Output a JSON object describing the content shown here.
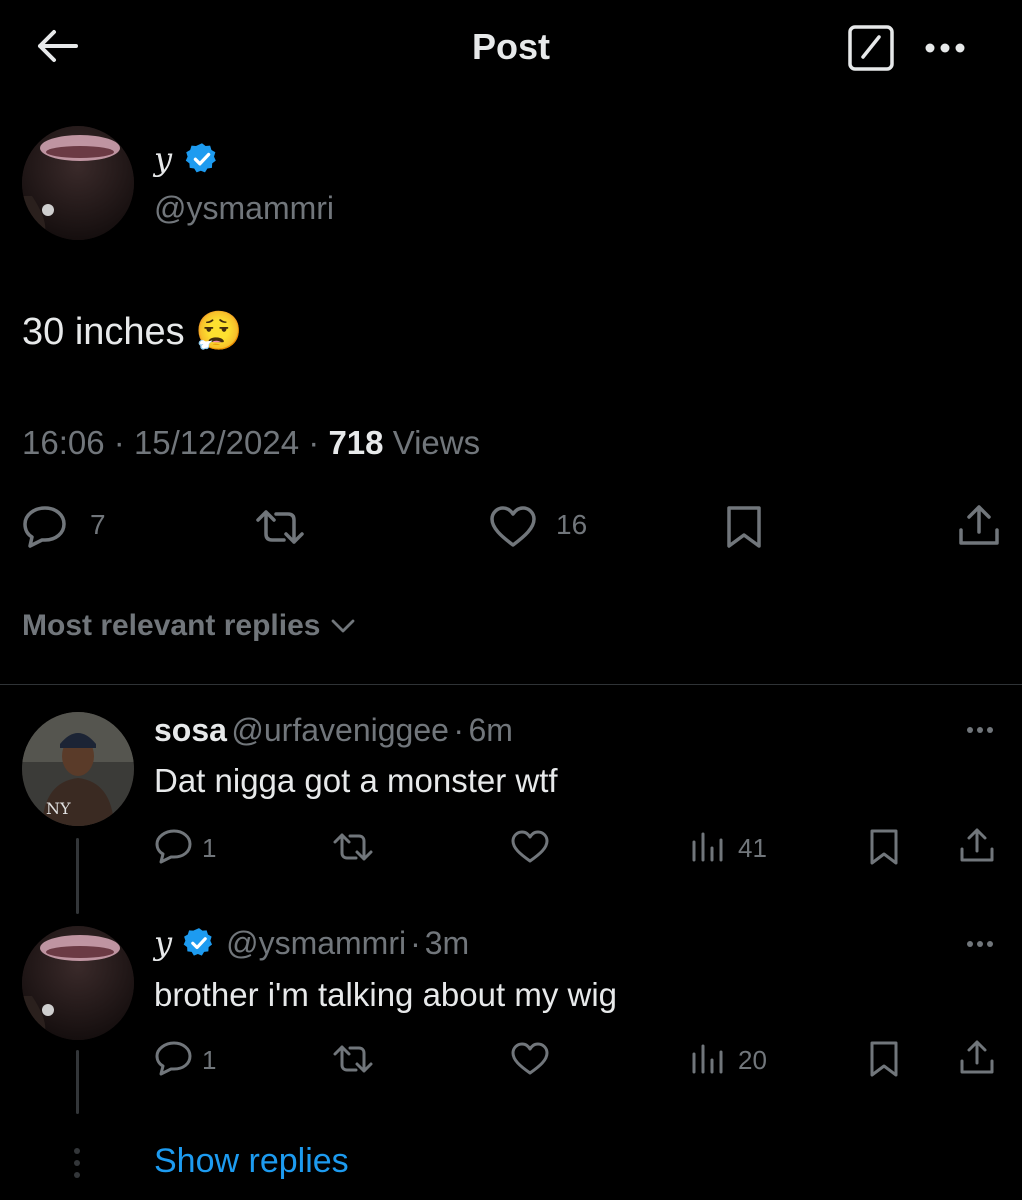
{
  "header": {
    "title": "Post"
  },
  "post": {
    "display_name": "y",
    "handle": "@ysmammri",
    "text": "30 inches 😮‍💨",
    "time": "16:06",
    "date": "15/12/2024",
    "views_count": "718",
    "views_label": "Views",
    "replies": "7",
    "likes": "16"
  },
  "sort": {
    "label": "Most relevant replies"
  },
  "replies": [
    {
      "display_name": "sosa",
      "handle": "@urfaveniggee",
      "time": "6m",
      "text": "Dat nigga got a monster wtf",
      "replies": "1",
      "views": "41"
    },
    {
      "display_name": "y",
      "handle": "@ysmammri",
      "time": "3m",
      "text": "brother i'm talking about my wig",
      "replies": "1",
      "views": "20"
    }
  ],
  "show_replies": "Show replies",
  "colors": {
    "background": "#000000",
    "accent": "#1d9bf0",
    "muted": "#71767b",
    "text": "#e7e9ea",
    "divider": "#2f3336"
  },
  "icons": [
    "back-arrow-icon",
    "compose-icon",
    "more-icon",
    "verified-badge-icon",
    "reply-icon",
    "repost-icon",
    "like-icon",
    "bookmark-icon",
    "share-icon",
    "views-icon",
    "chevron-down-icon"
  ]
}
